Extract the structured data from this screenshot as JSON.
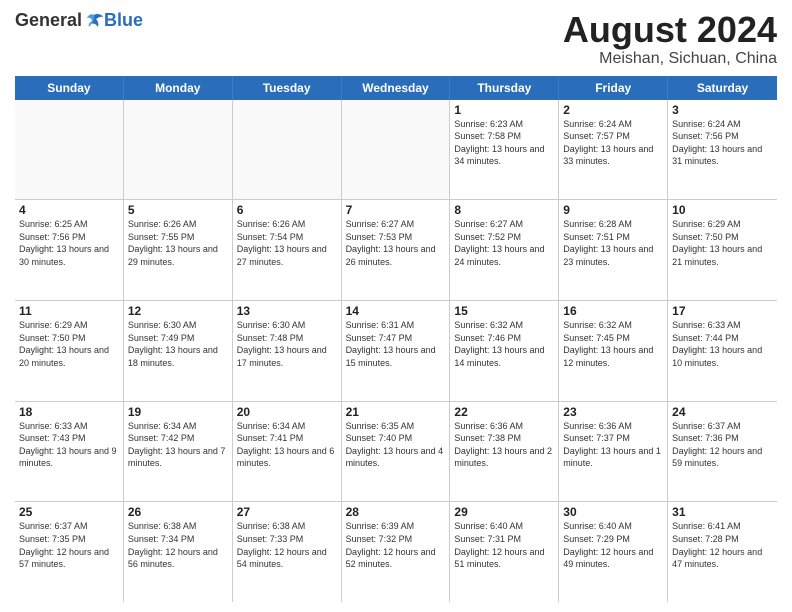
{
  "header": {
    "logo_general": "General",
    "logo_blue": "Blue",
    "month_title": "August 2024",
    "location": "Meishan, Sichuan, China"
  },
  "days_of_week": [
    "Sunday",
    "Monday",
    "Tuesday",
    "Wednesday",
    "Thursday",
    "Friday",
    "Saturday"
  ],
  "weeks": [
    [
      {
        "day": "",
        "info": ""
      },
      {
        "day": "",
        "info": ""
      },
      {
        "day": "",
        "info": ""
      },
      {
        "day": "",
        "info": ""
      },
      {
        "day": "1",
        "info": "Sunrise: 6:23 AM\nSunset: 7:58 PM\nDaylight: 13 hours and 34 minutes."
      },
      {
        "day": "2",
        "info": "Sunrise: 6:24 AM\nSunset: 7:57 PM\nDaylight: 13 hours and 33 minutes."
      },
      {
        "day": "3",
        "info": "Sunrise: 6:24 AM\nSunset: 7:56 PM\nDaylight: 13 hours and 31 minutes."
      }
    ],
    [
      {
        "day": "4",
        "info": "Sunrise: 6:25 AM\nSunset: 7:56 PM\nDaylight: 13 hours and 30 minutes."
      },
      {
        "day": "5",
        "info": "Sunrise: 6:26 AM\nSunset: 7:55 PM\nDaylight: 13 hours and 29 minutes."
      },
      {
        "day": "6",
        "info": "Sunrise: 6:26 AM\nSunset: 7:54 PM\nDaylight: 13 hours and 27 minutes."
      },
      {
        "day": "7",
        "info": "Sunrise: 6:27 AM\nSunset: 7:53 PM\nDaylight: 13 hours and 26 minutes."
      },
      {
        "day": "8",
        "info": "Sunrise: 6:27 AM\nSunset: 7:52 PM\nDaylight: 13 hours and 24 minutes."
      },
      {
        "day": "9",
        "info": "Sunrise: 6:28 AM\nSunset: 7:51 PM\nDaylight: 13 hours and 23 minutes."
      },
      {
        "day": "10",
        "info": "Sunrise: 6:29 AM\nSunset: 7:50 PM\nDaylight: 13 hours and 21 minutes."
      }
    ],
    [
      {
        "day": "11",
        "info": "Sunrise: 6:29 AM\nSunset: 7:50 PM\nDaylight: 13 hours and 20 minutes."
      },
      {
        "day": "12",
        "info": "Sunrise: 6:30 AM\nSunset: 7:49 PM\nDaylight: 13 hours and 18 minutes."
      },
      {
        "day": "13",
        "info": "Sunrise: 6:30 AM\nSunset: 7:48 PM\nDaylight: 13 hours and 17 minutes."
      },
      {
        "day": "14",
        "info": "Sunrise: 6:31 AM\nSunset: 7:47 PM\nDaylight: 13 hours and 15 minutes."
      },
      {
        "day": "15",
        "info": "Sunrise: 6:32 AM\nSunset: 7:46 PM\nDaylight: 13 hours and 14 minutes."
      },
      {
        "day": "16",
        "info": "Sunrise: 6:32 AM\nSunset: 7:45 PM\nDaylight: 13 hours and 12 minutes."
      },
      {
        "day": "17",
        "info": "Sunrise: 6:33 AM\nSunset: 7:44 PM\nDaylight: 13 hours and 10 minutes."
      }
    ],
    [
      {
        "day": "18",
        "info": "Sunrise: 6:33 AM\nSunset: 7:43 PM\nDaylight: 13 hours and 9 minutes."
      },
      {
        "day": "19",
        "info": "Sunrise: 6:34 AM\nSunset: 7:42 PM\nDaylight: 13 hours and 7 minutes."
      },
      {
        "day": "20",
        "info": "Sunrise: 6:34 AM\nSunset: 7:41 PM\nDaylight: 13 hours and 6 minutes."
      },
      {
        "day": "21",
        "info": "Sunrise: 6:35 AM\nSunset: 7:40 PM\nDaylight: 13 hours and 4 minutes."
      },
      {
        "day": "22",
        "info": "Sunrise: 6:36 AM\nSunset: 7:38 PM\nDaylight: 13 hours and 2 minutes."
      },
      {
        "day": "23",
        "info": "Sunrise: 6:36 AM\nSunset: 7:37 PM\nDaylight: 13 hours and 1 minute."
      },
      {
        "day": "24",
        "info": "Sunrise: 6:37 AM\nSunset: 7:36 PM\nDaylight: 12 hours and 59 minutes."
      }
    ],
    [
      {
        "day": "25",
        "info": "Sunrise: 6:37 AM\nSunset: 7:35 PM\nDaylight: 12 hours and 57 minutes."
      },
      {
        "day": "26",
        "info": "Sunrise: 6:38 AM\nSunset: 7:34 PM\nDaylight: 12 hours and 56 minutes."
      },
      {
        "day": "27",
        "info": "Sunrise: 6:38 AM\nSunset: 7:33 PM\nDaylight: 12 hours and 54 minutes."
      },
      {
        "day": "28",
        "info": "Sunrise: 6:39 AM\nSunset: 7:32 PM\nDaylight: 12 hours and 52 minutes."
      },
      {
        "day": "29",
        "info": "Sunrise: 6:40 AM\nSunset: 7:31 PM\nDaylight: 12 hours and 51 minutes."
      },
      {
        "day": "30",
        "info": "Sunrise: 6:40 AM\nSunset: 7:29 PM\nDaylight: 12 hours and 49 minutes."
      },
      {
        "day": "31",
        "info": "Sunrise: 6:41 AM\nSunset: 7:28 PM\nDaylight: 12 hours and 47 minutes."
      }
    ]
  ]
}
